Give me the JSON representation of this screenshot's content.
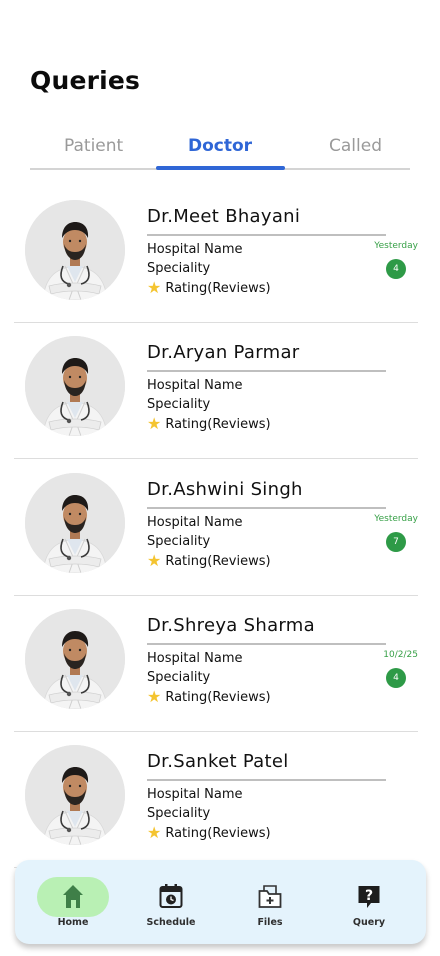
{
  "page": {
    "title": "Queries"
  },
  "tabs": [
    {
      "label": "Patient",
      "active": false
    },
    {
      "label": "Doctor",
      "active": true
    },
    {
      "label": "Called",
      "active": false
    }
  ],
  "doctors": [
    {
      "name": "Dr.Meet Bhayani",
      "hospital": "Hospital Name",
      "speciality": "Speciality",
      "rating": "Rating(Reviews)",
      "date": "Yesterday",
      "count": "4"
    },
    {
      "name": "Dr.Aryan Parmar",
      "hospital": "Hospital Name",
      "speciality": "Speciality",
      "rating": "Rating(Reviews)",
      "date": "",
      "count": ""
    },
    {
      "name": "Dr.Ashwini Singh",
      "hospital": "Hospital Name",
      "speciality": "Speciality",
      "rating": "Rating(Reviews)",
      "date": "Yesterday",
      "count": "7"
    },
    {
      "name": "Dr.Shreya Sharma",
      "hospital": "Hospital Name",
      "speciality": "Speciality",
      "rating": "Rating(Reviews)",
      "date": "10/2/25",
      "count": "4"
    },
    {
      "name": "Dr.Sanket Patel",
      "hospital": "Hospital Name",
      "speciality": "Speciality",
      "rating": "Rating(Reviews)",
      "date": "",
      "count": ""
    }
  ],
  "nav": [
    {
      "label": "Home",
      "icon": "home-icon",
      "active": true
    },
    {
      "label": "Schedule",
      "icon": "calendar-clock-icon",
      "active": false
    },
    {
      "label": "Files",
      "icon": "medical-folder-icon",
      "active": false
    },
    {
      "label": "Query",
      "icon": "question-chat-icon",
      "active": false
    }
  ],
  "colors": {
    "accent": "#2f66d6",
    "date": "#37a047",
    "badge": "#2e9a47",
    "nav_bg": "#e4f3fc",
    "home_pill": "#b9f0b4"
  }
}
